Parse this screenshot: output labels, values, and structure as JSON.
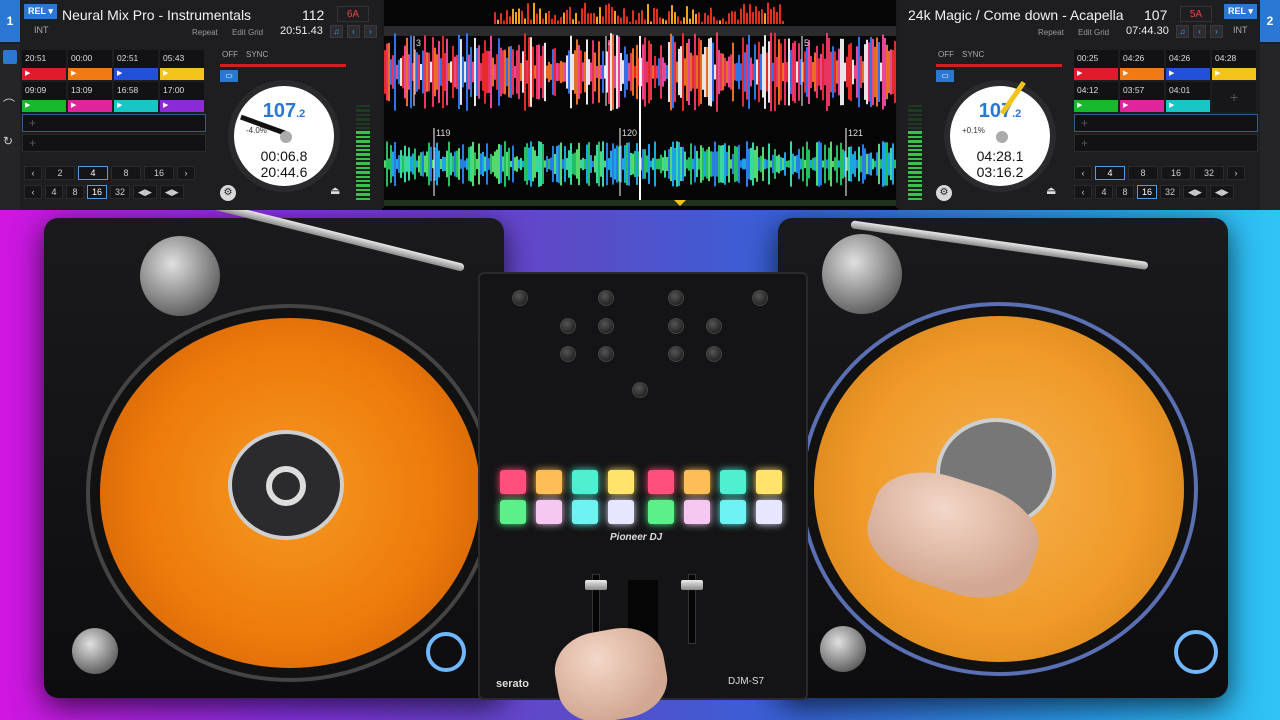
{
  "deck1": {
    "number": "1",
    "rel": "REL ▾",
    "int": "INT",
    "title": "Neural Mix Pro - Instrumentals",
    "bpm": "112",
    "key": "6A",
    "repeat": "Repeat",
    "edit_grid": "Edit Grid",
    "remaining_total": "20:51.43",
    "cues": [
      {
        "time": "20:51",
        "color": "#e01b2b"
      },
      {
        "time": "00:00",
        "color": "#f07a14"
      },
      {
        "time": "02:51",
        "color": "#2350d8"
      },
      {
        "time": "05:43",
        "color": "#f2c318"
      },
      {
        "time": "09:09",
        "color": "#18b82e"
      },
      {
        "time": "13:09",
        "color": "#e0259c"
      },
      {
        "time": "16:58",
        "color": "#19c6c6"
      },
      {
        "time": "17:00",
        "color": "#8b2ad6"
      }
    ],
    "off": "OFF",
    "sync": "SYNC",
    "platter_bpm": "107",
    "platter_bpm_dec": ".2",
    "rel_small": "REL",
    "pitch": "-4.0%",
    "elapsed": "00:06.8",
    "remaining": "20:44.6",
    "loop_beats": [
      "2",
      "4",
      "8",
      "16"
    ],
    "beatjump": [
      "4",
      "8",
      "16",
      "32"
    ]
  },
  "deck2": {
    "number": "2",
    "rel": "REL ▾",
    "int": "INT",
    "title": "24k Magic / Come down - Acapella",
    "bpm": "107",
    "key": "5A",
    "repeat": "Repeat",
    "edit_grid": "Edit Grid",
    "remaining_total": "07:44.30",
    "cues": [
      {
        "time": "00:25",
        "color": "#e01b2b"
      },
      {
        "time": "04:26",
        "color": "#f07a14"
      },
      {
        "time": "04:26",
        "color": "#2350d8"
      },
      {
        "time": "04:28",
        "color": "#f2c318"
      },
      {
        "time": "04:12",
        "color": "#18b82e"
      },
      {
        "time": "03:57",
        "color": "#e0259c"
      },
      {
        "time": "04:01",
        "color": "#19c6c6"
      }
    ],
    "off": "OFF",
    "sync": "SYNC",
    "platter_bpm": "107",
    "platter_bpm_dec": ".2",
    "rel_small": "REL",
    "pitch": "+0.1%",
    "elapsed": "04:28.1",
    "remaining": "03:16.2",
    "loop_beats": [
      "4",
      "8",
      "16",
      "32"
    ],
    "beatjump": [
      "4",
      "8",
      "16",
      "32"
    ]
  },
  "waveform": {
    "bar_markers": [
      "119",
      "120",
      "121"
    ],
    "cue_markers": [
      "3",
      "4",
      "5"
    ]
  },
  "mixer": {
    "brand": "Pioneer DJ",
    "model": "DJM-S7",
    "software": "serato",
    "pad_colors_top": [
      "#ff4f7a",
      "#ffbe55",
      "#4ef0d0",
      "#ffe36a",
      "#ff4f7a",
      "#ffbe55",
      "#4ef0d0",
      "#ffe36a"
    ],
    "pad_colors_bottom": [
      "#5cf08a",
      "#f4c8f0",
      "#6ff2f2",
      "#e6e6ff",
      "#5cf08a",
      "#f4c8f0",
      "#6ff2f2",
      "#e6e6ff"
    ]
  },
  "colors": {
    "accent": "#2a78d4",
    "record": "#f07f0c",
    "serato_red": "#d01f1f"
  },
  "icons": {
    "sync": "sync-icon",
    "headphones": "headphones-icon",
    "eject": "eject-icon",
    "settings": "gear-icon"
  }
}
